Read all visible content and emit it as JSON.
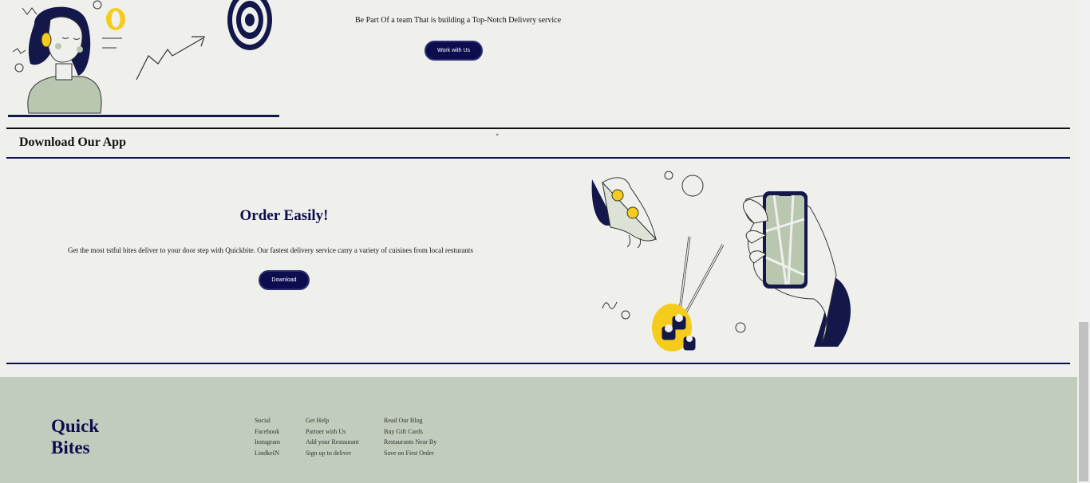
{
  "careers": {
    "tagline": "Be Part Of a team That is building a Top-Notch Delivery service",
    "button_label": "Work with Us"
  },
  "download_section": {
    "accordion_title": "Download Our App",
    "chevron": "˅",
    "title": "Order Easily!",
    "description": "Get the most tstful bites deliver to your door step with Quickbite. Our fastest delivery service carry a variety of cuisines from local resturants",
    "button_label": "Download"
  },
  "footer": {
    "brand_line1": "Quick",
    "brand_line2": "Bites",
    "social": [
      "Social",
      "Facebook",
      "Instagram",
      "LindkeIN"
    ],
    "help": [
      "Get Help",
      "Partner with Us",
      "Add your Restaurant",
      "Sign up to deliver"
    ],
    "blog": [
      "Read Our Blog",
      "Buy Gift Cards",
      "Restaurants Near By",
      "Save on First Order"
    ]
  },
  "colors": {
    "navy": "#0b0d4f",
    "page_bg": "#eff0ec",
    "footer_bg": "#c1ccbc",
    "accent_yellow": "#f5cc1b",
    "sage": "#b9c6b0"
  }
}
